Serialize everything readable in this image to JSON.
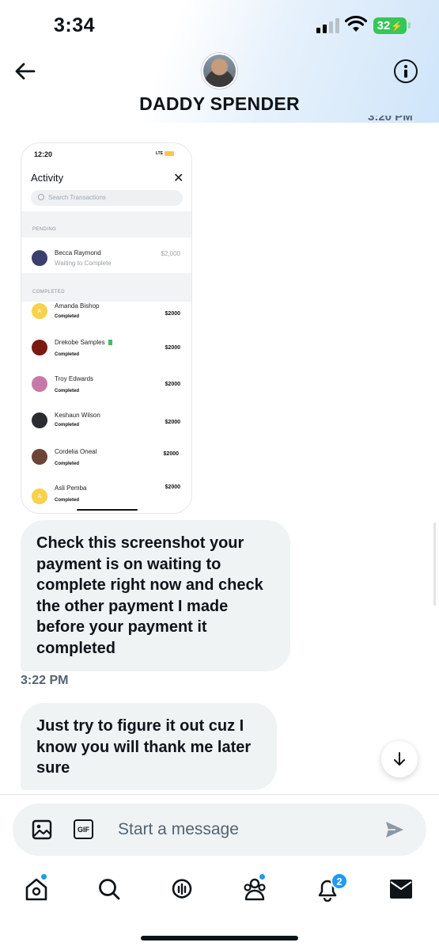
{
  "status_bar": {
    "time": "3:34",
    "battery": "32"
  },
  "header": {
    "contact_name": "DADDY SPENDER",
    "previous_timestamp_cut": "3:20 PM"
  },
  "shared_screenshot": {
    "status_time": "12:20",
    "network": "LTE",
    "title": "Activity",
    "close_glyph": "✕",
    "search_placeholder": "Search Transactions",
    "pending_label": "PENDING",
    "pending_item": {
      "name": "Becca Raymond",
      "status": "Waiting to Complete",
      "amount": "$2,000"
    },
    "completed_label": "COMPLETED",
    "completed_items": [
      {
        "initial": "A",
        "name": "Amanda Bishop",
        "status": "Completed",
        "amount": "$2000",
        "color": "#f7d24a"
      },
      {
        "initial": "",
        "name": "Drekobe Samples",
        "status": "Completed",
        "amount": "$2000",
        "color": "#7a1a12"
      },
      {
        "initial": "",
        "name": "Troy Edwards",
        "status": "Completed",
        "amount": "$2000",
        "color": "#c77aa6"
      },
      {
        "initial": "",
        "name": "Keshaun Wilson",
        "status": "Completed",
        "amount": "$2000",
        "color": "#2b2b33"
      },
      {
        "initial": "",
        "name": "Cordelia Oneal",
        "status": "Completed",
        "amount": "$2000",
        "color": "#6b4636"
      },
      {
        "initial": "A",
        "name": "Asli Pemba",
        "status": "Completed",
        "amount": "$2000",
        "color": "#f7d24a"
      }
    ]
  },
  "messages": [
    {
      "text": "Check this screenshot your payment is on waiting to complete right now and check the other payment I made before your payment it completed",
      "time": "3:22 PM"
    },
    {
      "text": "Just try to figure it out cuz I know you will thank me later sure"
    }
  ],
  "composer": {
    "placeholder": "Start a message",
    "gif_label": "GIF"
  },
  "nav": {
    "notifications_badge": "2"
  },
  "colors": {
    "accent": "#1d9bf0",
    "bubble": "#eff3f4",
    "battery": "#34c759"
  }
}
